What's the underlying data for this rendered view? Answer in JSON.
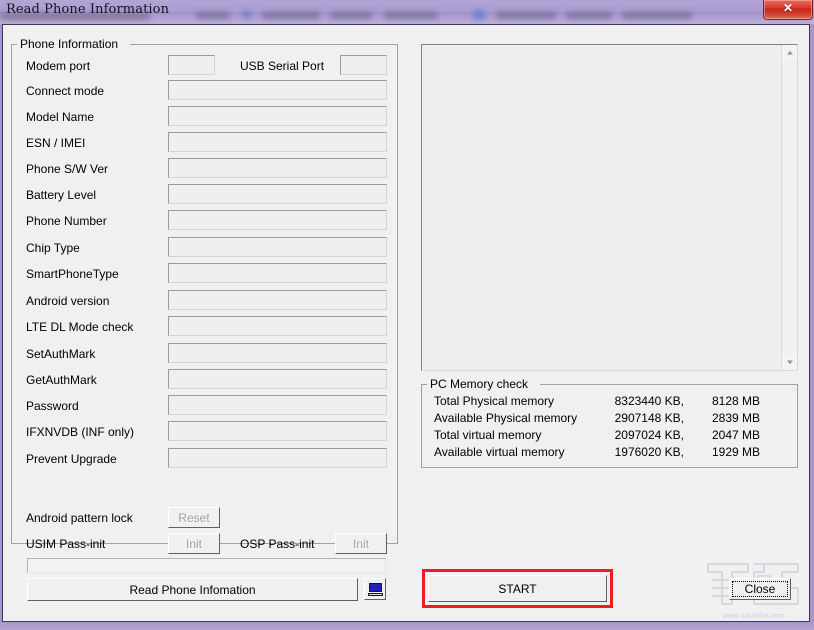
{
  "window": {
    "title": "Read Phone Information",
    "close_icon": "close-icon",
    "close_glyph": "✕"
  },
  "phone_group": {
    "title": "Phone Information",
    "usb_serial_port_label": "USB Serial Port",
    "fields": [
      {
        "label": "Modem port",
        "value": ""
      },
      {
        "label": "Connect mode",
        "value": ""
      },
      {
        "label": "Model Name",
        "value": ""
      },
      {
        "label": "ESN / IMEI",
        "value": ""
      },
      {
        "label": "Phone S/W Ver",
        "value": ""
      },
      {
        "label": "Battery Level",
        "value": ""
      },
      {
        "label": "Phone Number",
        "value": ""
      },
      {
        "label": "Chip Type",
        "value": ""
      },
      {
        "label": "SmartPhoneType",
        "value": ""
      },
      {
        "label": "Android version",
        "value": ""
      },
      {
        "label": "LTE DL Mode check",
        "value": ""
      },
      {
        "label": "SetAuthMark",
        "value": ""
      },
      {
        "label": "GetAuthMark",
        "value": ""
      },
      {
        "label": "Password",
        "value": ""
      },
      {
        "label": "IFXNVDB (INF only)",
        "value": ""
      },
      {
        "label": "Prevent Upgrade",
        "value": ""
      }
    ],
    "usb_serial_value": "",
    "modem_port_value": "",
    "actions": {
      "pattern_lock_label": "Android pattern lock",
      "pattern_lock_button": "Reset",
      "usim_label": "USIM Pass-init",
      "usim_button": "Init",
      "osp_label": "OSP Pass-init",
      "osp_button": "Init"
    },
    "read_button": "Read Phone Infomation",
    "pc_icon": "computer-icon",
    "progress_value": ""
  },
  "log_panel": {
    "content": "",
    "scroll_up_icon": "chevron-up-icon",
    "scroll_down_icon": "chevron-down-icon"
  },
  "memory_group": {
    "title": "PC Memory check",
    "rows": [
      {
        "label": "Total Physical memory",
        "kb": "8323440 KB,",
        "mb": "8128 MB"
      },
      {
        "label": "Available Physical memory",
        "kb": "2907148 KB,",
        "mb": "2839 MB"
      },
      {
        "label": "Total virtual memory",
        "kb": "2097024 KB,",
        "mb": "2047 MB"
      },
      {
        "label": "Available virtual memory",
        "kb": "1976020 KB,",
        "mb": "1929 MB"
      }
    ]
  },
  "footer": {
    "start_button": "START",
    "close_button": "Close"
  },
  "watermark": {
    "url": "www.xiazaiba.com"
  },
  "colors": {
    "titlebar": "#a899d0",
    "close_red": "#d83c2c",
    "highlight_red": "#ee1c25",
    "window_bg": "#f0f0f0",
    "field_bg": "#efefef"
  }
}
